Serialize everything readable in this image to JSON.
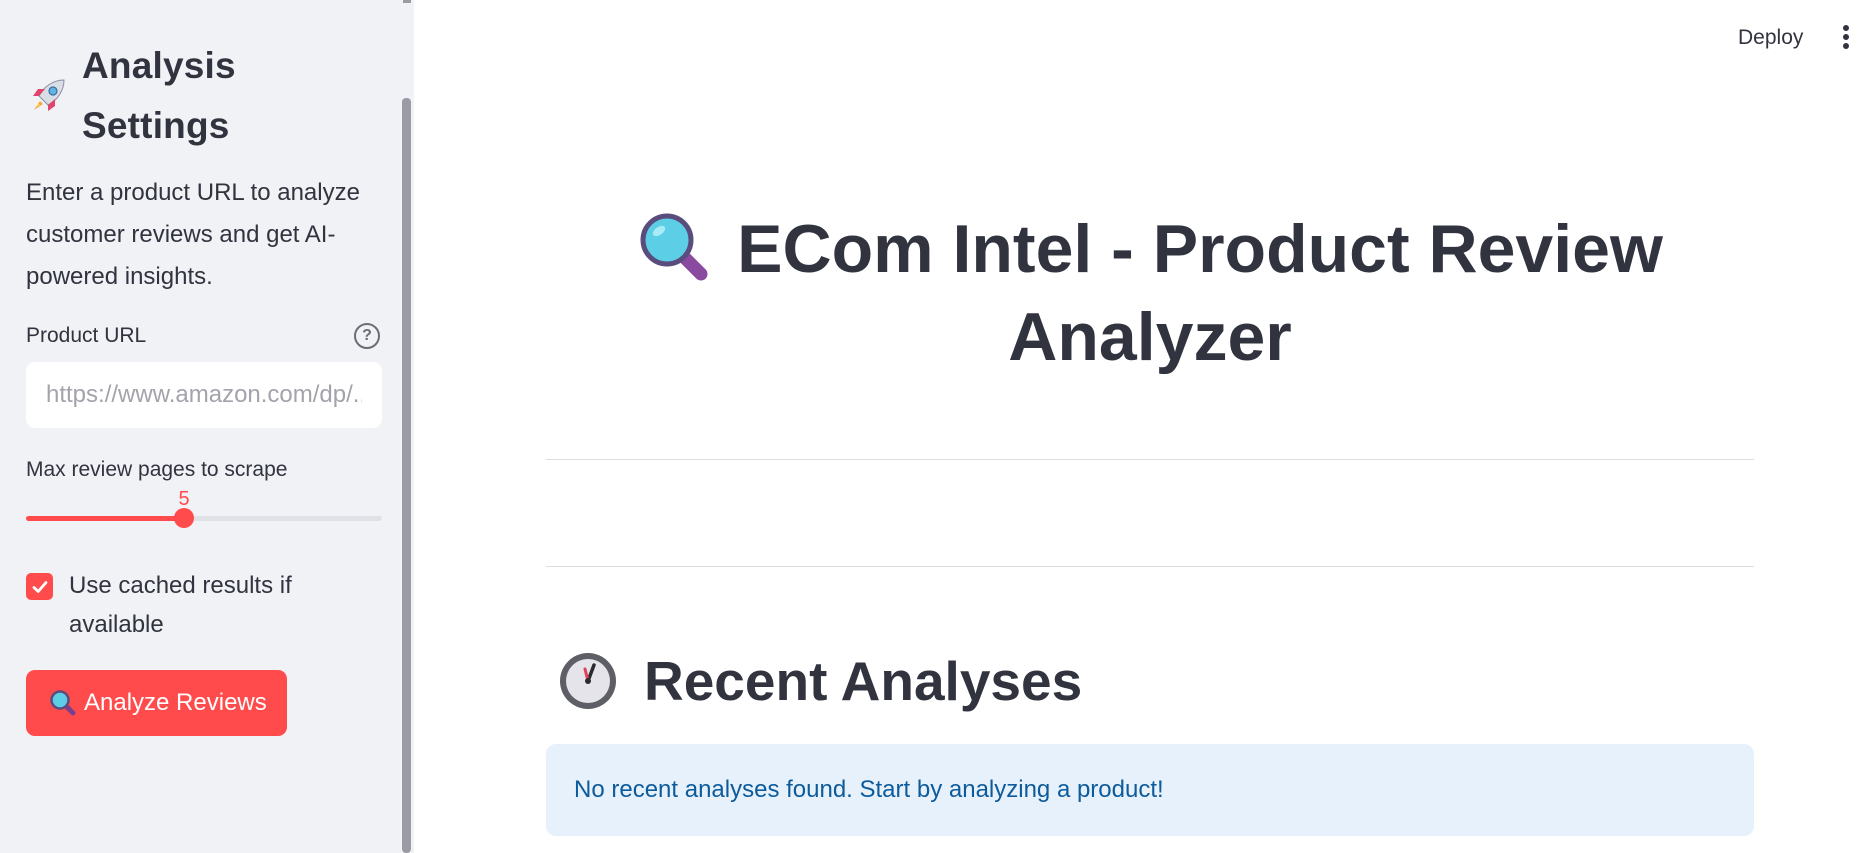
{
  "sidebar": {
    "title": "Analysis Settings",
    "title_icon": "rocket-icon",
    "description": "Enter a product URL to analyze customer reviews and get AI-powered insights.",
    "url_field": {
      "label": "Product URL",
      "placeholder": "https://www.amazon.com/dp/...",
      "value": ""
    },
    "slider": {
      "label": "Max review pages to scrape",
      "value": "5",
      "fill_fraction": 0.445
    },
    "cache_checkbox": {
      "label": "Use cached results if available",
      "checked": true
    },
    "analyze_button": {
      "label": "Analyze Reviews",
      "icon": "magnifier-icon"
    }
  },
  "header": {
    "deploy_label": "Deploy",
    "menu_icon": "kebab-menu-icon"
  },
  "main": {
    "title": "ECom Intel - Product Review Analyzer",
    "title_icon": "magnifier-icon",
    "recent_section": {
      "title": "Recent Analyses",
      "icon": "stopwatch-icon",
      "info_message": "No recent analyses found. Start by analyzing a product!"
    }
  },
  "colors": {
    "accent": "#ff4b4b",
    "sidebar_bg": "#f0f2f6",
    "text": "#31333f",
    "info_bg": "#e6f1fc",
    "info_text": "#0d5b9b"
  }
}
